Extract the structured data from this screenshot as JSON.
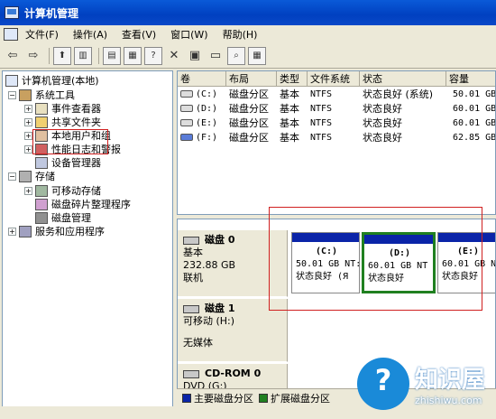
{
  "window": {
    "title": "计算机管理"
  },
  "menu": [
    "文件(F)",
    "操作(A)",
    "查看(V)",
    "窗口(W)",
    "帮助(H)"
  ],
  "toolbar": [
    "back-icon",
    "forward-icon",
    "up-icon",
    "show-hide-tree-icon",
    "properties-icon",
    "export-icon",
    "help-icon",
    "delete-icon",
    "properties2-icon",
    "open-folder-icon",
    "search-icon",
    "print-icon"
  ],
  "tree": {
    "root": "计算机管理(本地)",
    "system_tools": "系统工具",
    "event_viewer": "事件查看器",
    "shared_folders": "共享文件夹",
    "local_users": "本地用户和组",
    "perf_logs": "性能日志和警报",
    "device_manager": "设备管理器",
    "storage": "存储",
    "removable_storage": "可移动存储",
    "defrag": "磁盘碎片整理程序",
    "disk_management": "磁盘管理",
    "services": "服务和应用程序"
  },
  "volume_table": {
    "headers": [
      "卷",
      "布局",
      "类型",
      "文件系统",
      "状态",
      "容量"
    ],
    "rows": [
      {
        "volume": "(C:)",
        "layout": "磁盘分区",
        "type": "基本",
        "fs": "NTFS",
        "status": "状态良好 (系统)",
        "capacity": "50.01 GB"
      },
      {
        "volume": "(D:)",
        "layout": "磁盘分区",
        "type": "基本",
        "fs": "NTFS",
        "status": "状态良好",
        "capacity": "60.01 GB"
      },
      {
        "volume": "(E:)",
        "layout": "磁盘分区",
        "type": "基本",
        "fs": "NTFS",
        "status": "状态良好",
        "capacity": "60.01 GB"
      },
      {
        "volume": "(F:)",
        "layout": "磁盘分区",
        "type": "基本",
        "fs": "NTFS",
        "status": "状态良好",
        "capacity": "62.85 GB"
      }
    ]
  },
  "disks": {
    "disk0": {
      "name": "磁盘 0",
      "type": "基本",
      "size": "232.88 GB",
      "state": "联机",
      "partitions": [
        {
          "name": "(C:)",
          "size": "50.01 GB NT:",
          "status": "状态良好 (Я"
        },
        {
          "name": "(D:)",
          "size": "60.01 GB NT",
          "status": "状态良好"
        },
        {
          "name": "(E:)",
          "size": "60.01 GB NT",
          "status": "状态良好"
        }
      ]
    },
    "disk1": {
      "name": "磁盘 1",
      "type": "可移动 (H:)",
      "media": "无媒体"
    },
    "cdrom0": {
      "name": "CD-ROM 0",
      "type": "DVD (G:)"
    }
  },
  "legend": [
    "主要磁盘分区",
    "扩展磁盘分区"
  ],
  "watermark": {
    "name": "知识屋",
    "url": "zhishiwu.com"
  },
  "colors": {
    "primary_partition": "#0a24a8",
    "extended_partition": "#208020",
    "highlight": "#d02020"
  }
}
